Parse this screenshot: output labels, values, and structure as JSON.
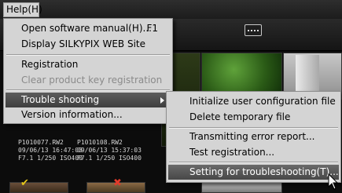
{
  "menubar": {
    "help_label": "Help(H)"
  },
  "file_info": [
    {
      "name": "P1010077.RW2",
      "datetime": "09/06/13 16:47:03",
      "exposure": "F7.1 1/250 ISO400"
    },
    {
      "name": "P1010108.RW2",
      "datetime": "09/06/13 15:37:03",
      "exposure": "F7.1 1/250 ISO400"
    }
  ],
  "flags": {
    "ok_glyph": "✔",
    "x_glyph": "✖"
  },
  "help_menu": {
    "items": [
      {
        "label": "Open software manual(H)...",
        "shortcut": "F1"
      },
      {
        "label": "Display SILKYPIX WEB Site"
      },
      {
        "label": "Registration"
      },
      {
        "label": "Clear product key registration"
      },
      {
        "label": "Trouble shooting"
      },
      {
        "label": "Version information..."
      }
    ]
  },
  "troubleshoot_menu": {
    "items": [
      {
        "label": "Initialize user configuration file"
      },
      {
        "label": "Delete temporary file"
      },
      {
        "label": "Transmitting error report..."
      },
      {
        "label": "Test registration..."
      },
      {
        "label": "Setting for troubleshooting(T)..."
      }
    ]
  },
  "colors": {
    "menu_bg": "#d4d4d4",
    "highlight": "#474747",
    "disabled_text": "#8a8a8a",
    "ok_flag": "#e6c619",
    "reject_flag": "#e23a2a"
  },
  "icons": [
    "display-view-icon",
    "submenu-arrow-icon",
    "checkmark-flag-icon",
    "reject-flag-icon",
    "mouse-pointer-icon"
  ]
}
